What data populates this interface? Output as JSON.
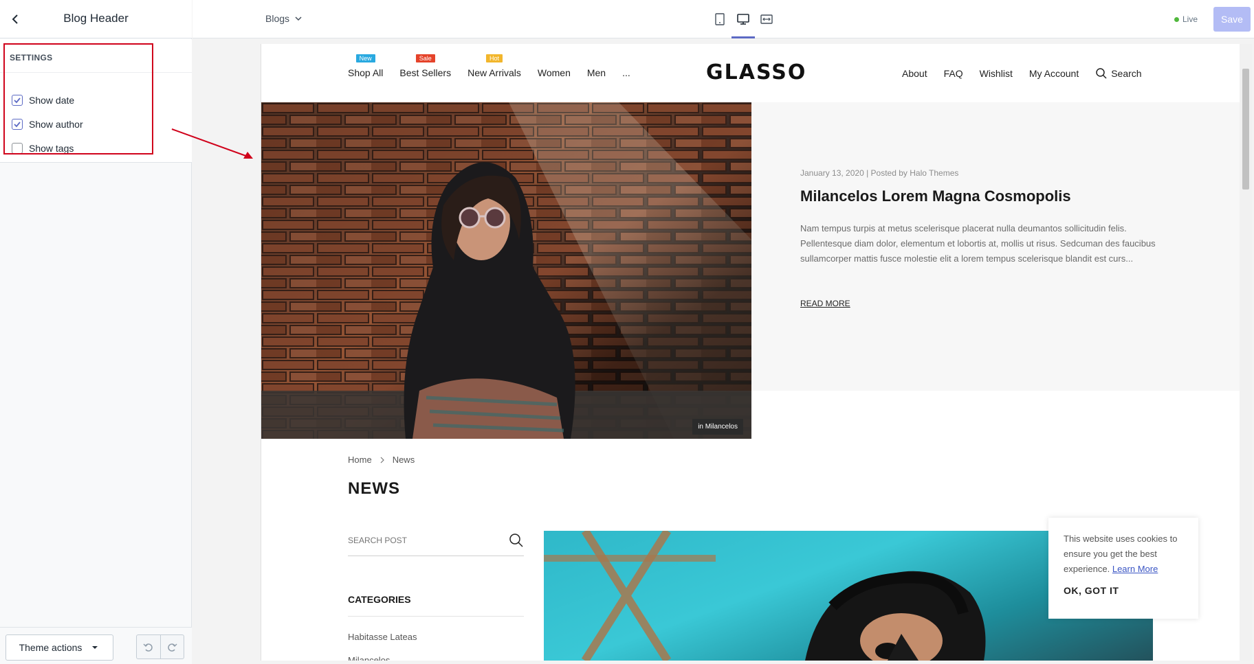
{
  "sidebar": {
    "title": "Blog Header",
    "section_label": "SETTINGS",
    "options": [
      {
        "label": "Show date",
        "checked": true
      },
      {
        "label": "Show author",
        "checked": true
      },
      {
        "label": "Show tags",
        "checked": false
      }
    ],
    "footer": {
      "theme_actions_label": "Theme actions"
    }
  },
  "topbar": {
    "page_select": "Blogs",
    "live_label": "Live",
    "save_label": "Save"
  },
  "store": {
    "logo": "GLASSO",
    "nav_left": [
      {
        "label": "Shop All",
        "badge": "New",
        "badge_color": "#29a9e0"
      },
      {
        "label": "Best Sellers",
        "badge": "Sale",
        "badge_color": "#e5432a"
      },
      {
        "label": "New Arrivals",
        "badge": "Hot",
        "badge_color": "#f2b62c"
      },
      {
        "label": "Women",
        "badge": "",
        "badge_color": ""
      },
      {
        "label": "Men",
        "badge": "",
        "badge_color": ""
      },
      {
        "label": "...",
        "badge": "",
        "badge_color": ""
      }
    ],
    "nav_right": [
      "About",
      "FAQ",
      "Wishlist",
      "My Account"
    ],
    "search_label": "Search"
  },
  "hero": {
    "tag": "in Milancelos",
    "meta": "January 13, 2020  |  Posted by Halo Themes",
    "title": "Milancelos Lorem Magna Cosmopolis",
    "excerpt": "Nam tempus turpis at metus scelerisque placerat nulla deumantos sollicitudin felis. Pellentesque diam dolor, elementum et lobortis at, mollis ut risus. Sedcuman des faucibus sullamcorper mattis fusce molestie elit a lorem tempus scelerisque blandit est curs...",
    "read_more": "READ MORE"
  },
  "blog": {
    "breadcrumb": [
      "Home",
      "News"
    ],
    "title": "NEWS",
    "search_placeholder": "SEARCH POST",
    "categories_title": "CATEGORIES",
    "categories": [
      "Habitasse Lateas",
      "Milancelos"
    ]
  },
  "cookie": {
    "text": "This website uses cookies to ensure you get the best experience.",
    "link": "Learn More",
    "ok": "OK, GOT IT"
  }
}
